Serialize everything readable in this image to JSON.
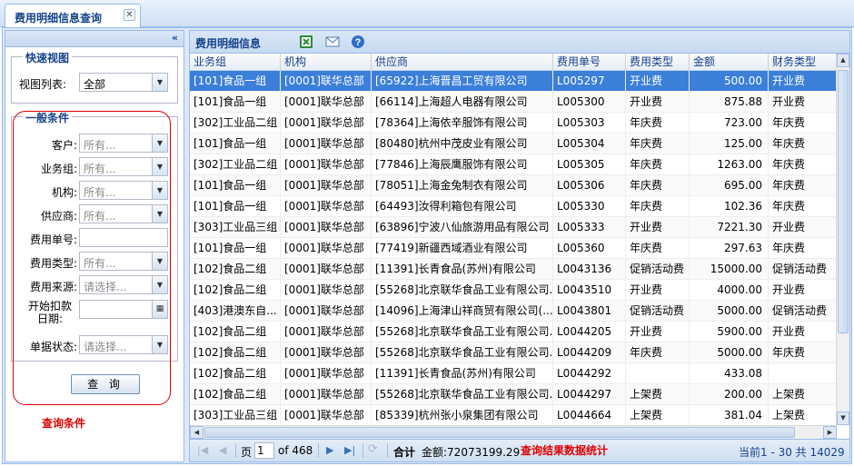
{
  "tab": {
    "title": "费用明细信息查询",
    "close": "✕"
  },
  "left": {
    "collapse": "«",
    "quick_view": {
      "legend": "快速视图",
      "label": "视图列表:",
      "value": "全部"
    },
    "conditions": {
      "legend": "一般条件",
      "fields": [
        {
          "label": "客户:",
          "placeholder": "所有..."
        },
        {
          "label": "业务组:",
          "placeholder": "所有..."
        },
        {
          "label": "机构:",
          "placeholder": "所有..."
        },
        {
          "label": "供应商:",
          "placeholder": "所有..."
        },
        {
          "label": "费用单号:"
        },
        {
          "label": "费用类型:",
          "placeholder": "所有..."
        },
        {
          "label": "费用来源:",
          "placeholder": "请选择..."
        },
        {
          "label": "开始扣款日期:"
        },
        {
          "label": "单据状态:",
          "placeholder": "请选择..."
        }
      ]
    },
    "query_button": "查 询",
    "note": "查询条件"
  },
  "grid": {
    "title": "费用明细信息",
    "toolbar_icons": [
      "excel-export-icon",
      "email-icon",
      "help-icon"
    ],
    "columns": [
      "业务组",
      "机构",
      "供应商",
      "费用单号",
      "费用类型",
      "金额",
      "财务类型"
    ],
    "rows": [
      [
        "[101]食品一组",
        "[0001]联华总部",
        "[65922]上海晋昌工贸有限公司",
        "L005297",
        "开业费",
        "500.00",
        "开业费"
      ],
      [
        "[101]食品一组",
        "[0001]联华总部",
        "[66114]上海超人电器有限公司",
        "L005300",
        "开业费",
        "875.88",
        "开业费"
      ],
      [
        "[302]工业品二组",
        "[0001]联华总部",
        "[78364]上海依辛服饰有限公司",
        "L005303",
        "年庆费",
        "723.00",
        "年庆费"
      ],
      [
        "[101]食品一组",
        "[0001]联华总部",
        "[80480]杭州中茂皮业有限公司",
        "L005304",
        "年庆费",
        "125.00",
        "年庆费"
      ],
      [
        "[302]工业品二组",
        "[0001]联华总部",
        "[77846]上海辰鹰服饰有限公司",
        "L005305",
        "年庆费",
        "1263.00",
        "年庆费"
      ],
      [
        "[101]食品一组",
        "[0001]联华总部",
        "[78051]上海金兔制衣有限公司",
        "L005306",
        "年庆费",
        "695.00",
        "年庆费"
      ],
      [
        "[101]食品一组",
        "[0001]联华总部",
        "[64493]汝得利箱包有限公司",
        "L005330",
        "年庆费",
        "102.36",
        "年庆费"
      ],
      [
        "[303]工业品三组",
        "[0001]联华总部",
        "[63896]宁波八仙旅游用品有限公司",
        "L005333",
        "开业费",
        "7221.30",
        "开业费"
      ],
      [
        "[101]食品一组",
        "[0001]联华总部",
        "[77419]新疆西域酒业有限公司",
        "L005360",
        "年庆费",
        "297.63",
        "年庆费"
      ],
      [
        "[102]食品二组",
        "[0001]联华总部",
        "[11391]长青食品(苏州)有限公司",
        "L0043136",
        "促销活动费",
        "15000.00",
        "促销活动费"
      ],
      [
        "[102]食品二组",
        "[0001]联华总部",
        "[55268]北京联华食品工业有限公司...",
        "L0043510",
        "开业费",
        "4000.00",
        "开业费"
      ],
      [
        "[403]港澳东自...",
        "[0001]联华总部",
        "[14096]上海津山祥商贸有限公司(...",
        "L0043801",
        "促销活动费",
        "5000.00",
        "促销活动费"
      ],
      [
        "[102]食品二组",
        "[0001]联华总部",
        "[55268]北京联华食品工业有限公司...",
        "L0044205",
        "开业费",
        "5900.00",
        "开业费"
      ],
      [
        "[102]食品二组",
        "[0001]联华总部",
        "[55268]北京联华食品工业有限公司...",
        "L0044209",
        "年庆费",
        "5000.00",
        "年庆费"
      ],
      [
        "[102]食品二组",
        "[0001]联华总部",
        "[11391]长青食品(苏州)有限公司",
        "L0044292",
        "",
        "433.08",
        ""
      ],
      [
        "[102]食品二组",
        "[0001]联华总部",
        "[55268]北京联华食品工业有限公司...",
        "L0044297",
        "上架费",
        "200.00",
        "上架费"
      ],
      [
        "[303]工业品三组",
        "[0001]联华总部",
        "[85339]杭州张小泉集团有限公司",
        "L0044664",
        "上架费",
        "381.04",
        "上架费"
      ]
    ],
    "selected_row": 0
  },
  "pager": {
    "page_label": "页",
    "page": "1",
    "of_total": "of 468",
    "sum_label": "合计",
    "sum_value": "金额:72073199.29",
    "note": "查询结果数据统计",
    "summary": "当前1 - 30 共 14029"
  }
}
